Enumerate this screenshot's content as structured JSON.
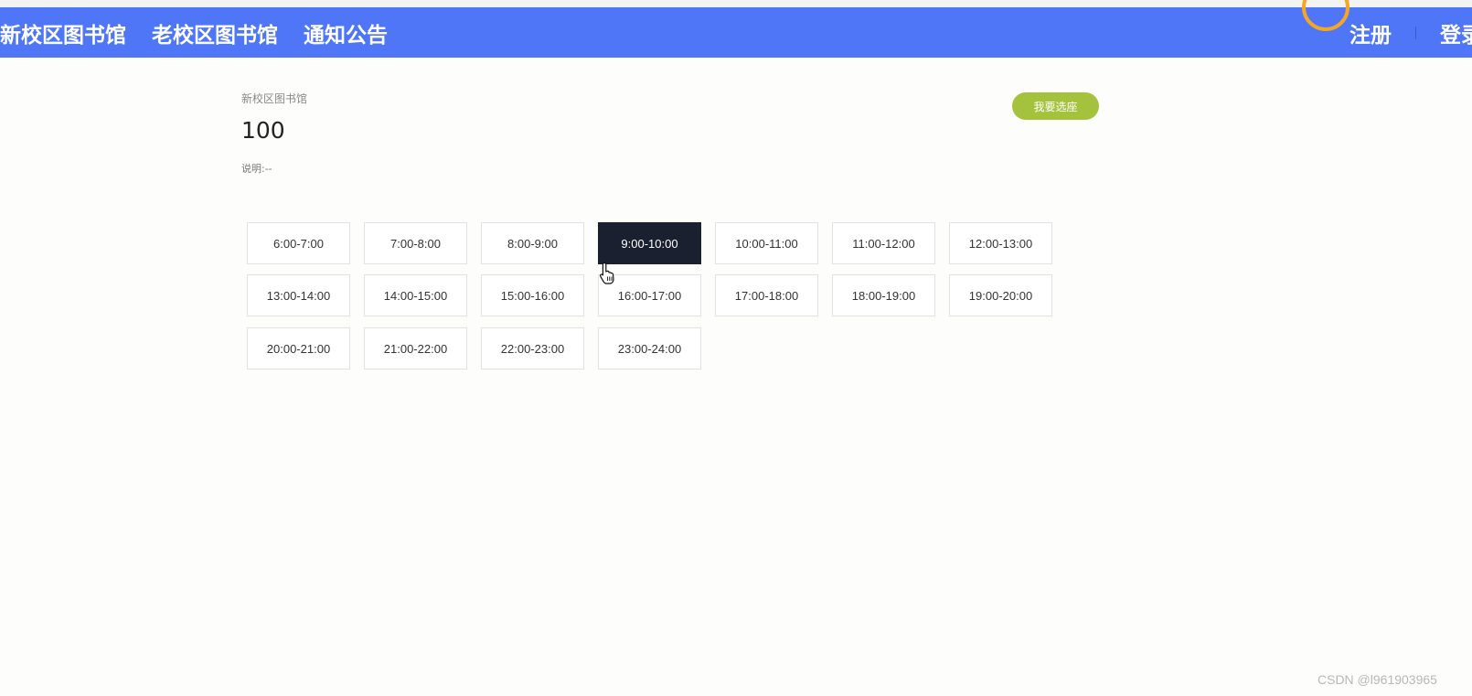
{
  "nav": {
    "links": [
      "新校区图书馆",
      "老校区图书馆",
      "通知公告"
    ],
    "register": "注册",
    "login": "登录"
  },
  "page": {
    "breadcrumb": "新校区图书馆",
    "title": "100",
    "note": "说明:--",
    "choose_button": "我要选座"
  },
  "time_slots": [
    "6:00-7:00",
    "7:00-8:00",
    "8:00-9:00",
    "9:00-10:00",
    "10:00-11:00",
    "11:00-12:00",
    "12:00-13:00",
    "13:00-14:00",
    "14:00-15:00",
    "15:00-16:00",
    "16:00-17:00",
    "17:00-18:00",
    "18:00-19:00",
    "19:00-20:00",
    "20:00-21:00",
    "21:00-22:00",
    "22:00-23:00",
    "23:00-24:00"
  ],
  "selected_slot": "9:00-10:00",
  "watermark": "CSDN @l961903965",
  "colors": {
    "navbar": "#4f76f6",
    "choose_button": "#a4c23c",
    "selected_slot": "#1b2031"
  }
}
